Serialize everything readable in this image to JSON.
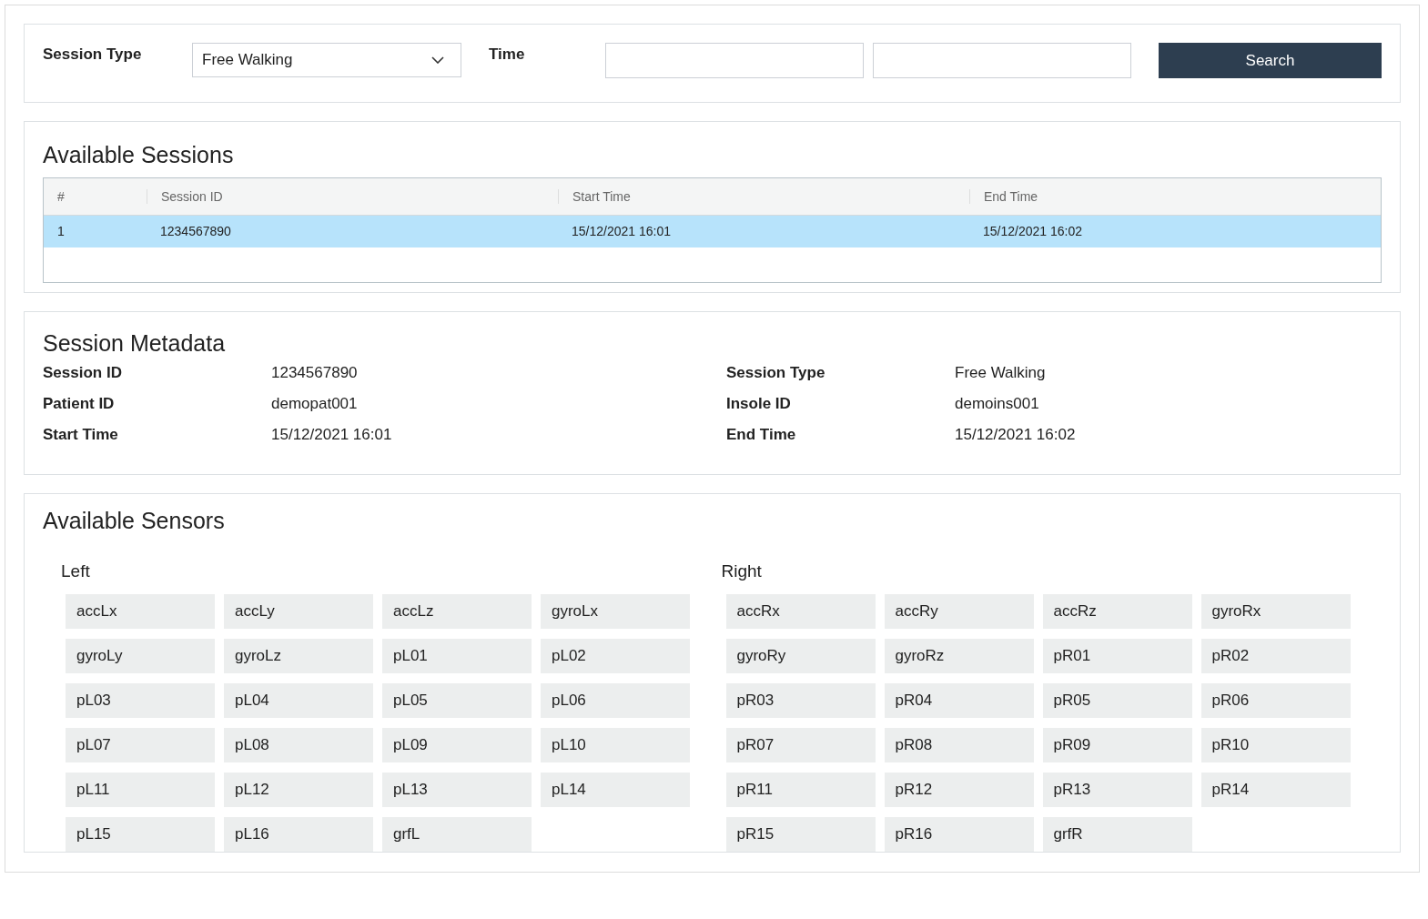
{
  "filter": {
    "session_type_label": "Session Type",
    "session_type_value": "Free Walking",
    "time_label": "Time",
    "search_button": "Search"
  },
  "sessions": {
    "title": "Available Sessions",
    "columns": [
      "#",
      "Session ID",
      "Start Time",
      "End Time"
    ],
    "rows": [
      {
        "cells": [
          "1",
          "1234567890",
          "15/12/2021 16:01",
          "15/12/2021 16:02"
        ],
        "selected": true
      }
    ]
  },
  "metadata": {
    "title": "Session Metadata",
    "fields": [
      {
        "label": "Session ID",
        "value": "1234567890"
      },
      {
        "label": "Session Type",
        "value": "Free Walking"
      },
      {
        "label": "Patient ID",
        "value": "demopat001"
      },
      {
        "label": "Insole ID",
        "value": "demoins001"
      },
      {
        "label": "Start Time",
        "value": "15/12/2021 16:01"
      },
      {
        "label": "End Time",
        "value": "15/12/2021 16:02"
      }
    ]
  },
  "sensors": {
    "title": "Available Sensors",
    "groups": [
      {
        "label": "Left",
        "items": [
          "accLx",
          "accLy",
          "accLz",
          "gyroLx",
          "gyroLy",
          "gyroLz",
          "pL01",
          "pL02",
          "pL03",
          "pL04",
          "pL05",
          "pL06",
          "pL07",
          "pL08",
          "pL09",
          "pL10",
          "pL11",
          "pL12",
          "pL13",
          "pL14",
          "pL15",
          "pL16",
          "grfL"
        ]
      },
      {
        "label": "Right",
        "items": [
          "accRx",
          "accRy",
          "accRz",
          "gyroRx",
          "gyroRy",
          "gyroRz",
          "pR01",
          "pR02",
          "pR03",
          "pR04",
          "pR05",
          "pR06",
          "pR07",
          "pR08",
          "pR09",
          "pR10",
          "pR11",
          "pR12",
          "pR13",
          "pR14",
          "pR15",
          "pR16",
          "grfR"
        ]
      }
    ]
  }
}
